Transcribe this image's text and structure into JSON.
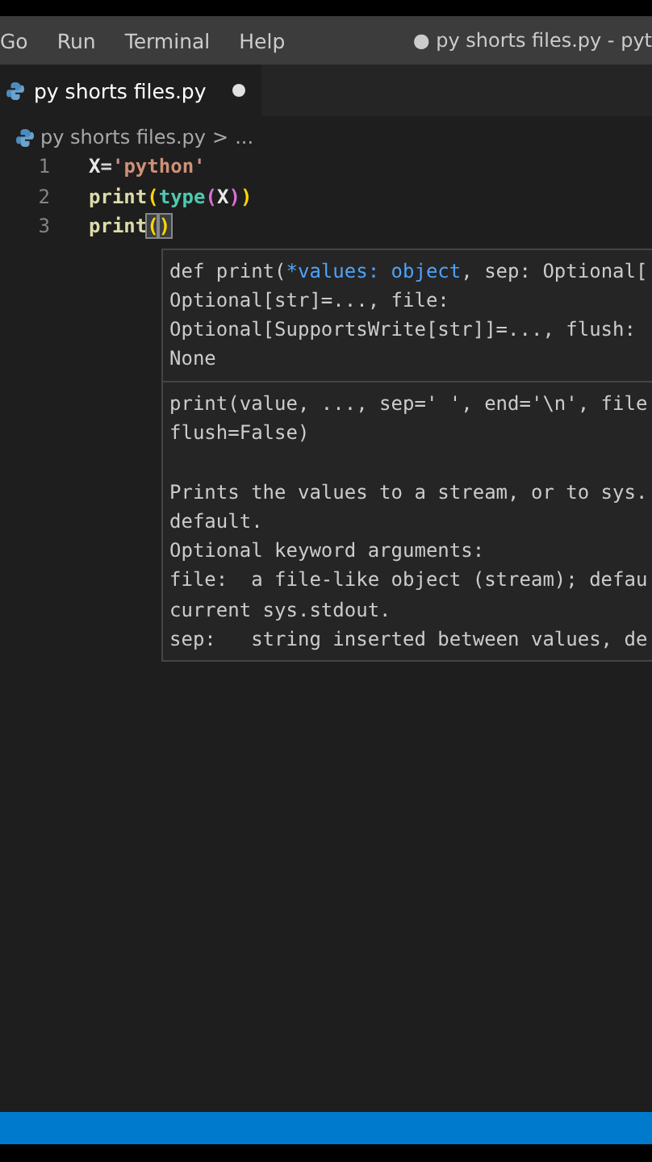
{
  "menu_bar": {
    "items": [
      "Go",
      "Run",
      "Terminal",
      "Help"
    ],
    "title": "● py shorts files.py - pyt"
  },
  "tabs": [
    {
      "label": "py shorts files.py",
      "selected": true,
      "modified": true
    }
  ],
  "breadcrumb": {
    "file": "py shorts files.py",
    "separator": ">",
    "rest": "..."
  },
  "editor": {
    "lines": [
      {
        "number": "1",
        "tokens": [
          {
            "text": "X",
            "kind": "variable"
          },
          {
            "text": "=",
            "kind": "operator"
          },
          {
            "text": "'python'",
            "kind": "string"
          }
        ]
      },
      {
        "number": "2",
        "tokens": [
          {
            "text": "print",
            "kind": "function"
          },
          {
            "text": "(",
            "kind": "bracket1"
          },
          {
            "text": "type",
            "kind": "builtin"
          },
          {
            "text": "(",
            "kind": "bracket2"
          },
          {
            "text": "X",
            "kind": "variable"
          },
          {
            "text": ")",
            "kind": "bracket2"
          },
          {
            "text": ")",
            "kind": "bracket1"
          }
        ]
      },
      {
        "number": "3",
        "tokens": [
          {
            "text": "print",
            "kind": "function"
          },
          {
            "text": "(",
            "kind": "match"
          },
          {
            "text": ")",
            "kind": "match"
          }
        ]
      }
    ]
  },
  "hover": {
    "signature": [
      [
        {
          "text": "def print(",
          "active": false
        },
        {
          "text": "*values: object",
          "active": true
        },
        {
          "text": ", sep: Optional[",
          "active": false
        }
      ],
      [
        {
          "text": "Optional[str]=..., file:",
          "active": false
        }
      ],
      [
        {
          "text": "Optional[SupportsWrite[str]]=..., flush:",
          "active": false
        }
      ],
      [
        {
          "text": "None",
          "active": false
        }
      ]
    ],
    "doc": [
      [
        "print(value, ..., sep=' ', end='\\n', file",
        "flush=False)"
      ],
      [
        "Prints the values to a stream, or to sys.",
        "default.",
        "Optional keyword arguments:",
        "file:  a file-like object (stream); defau",
        "current sys.stdout.",
        "sep:   string inserted between values, de"
      ]
    ]
  }
}
